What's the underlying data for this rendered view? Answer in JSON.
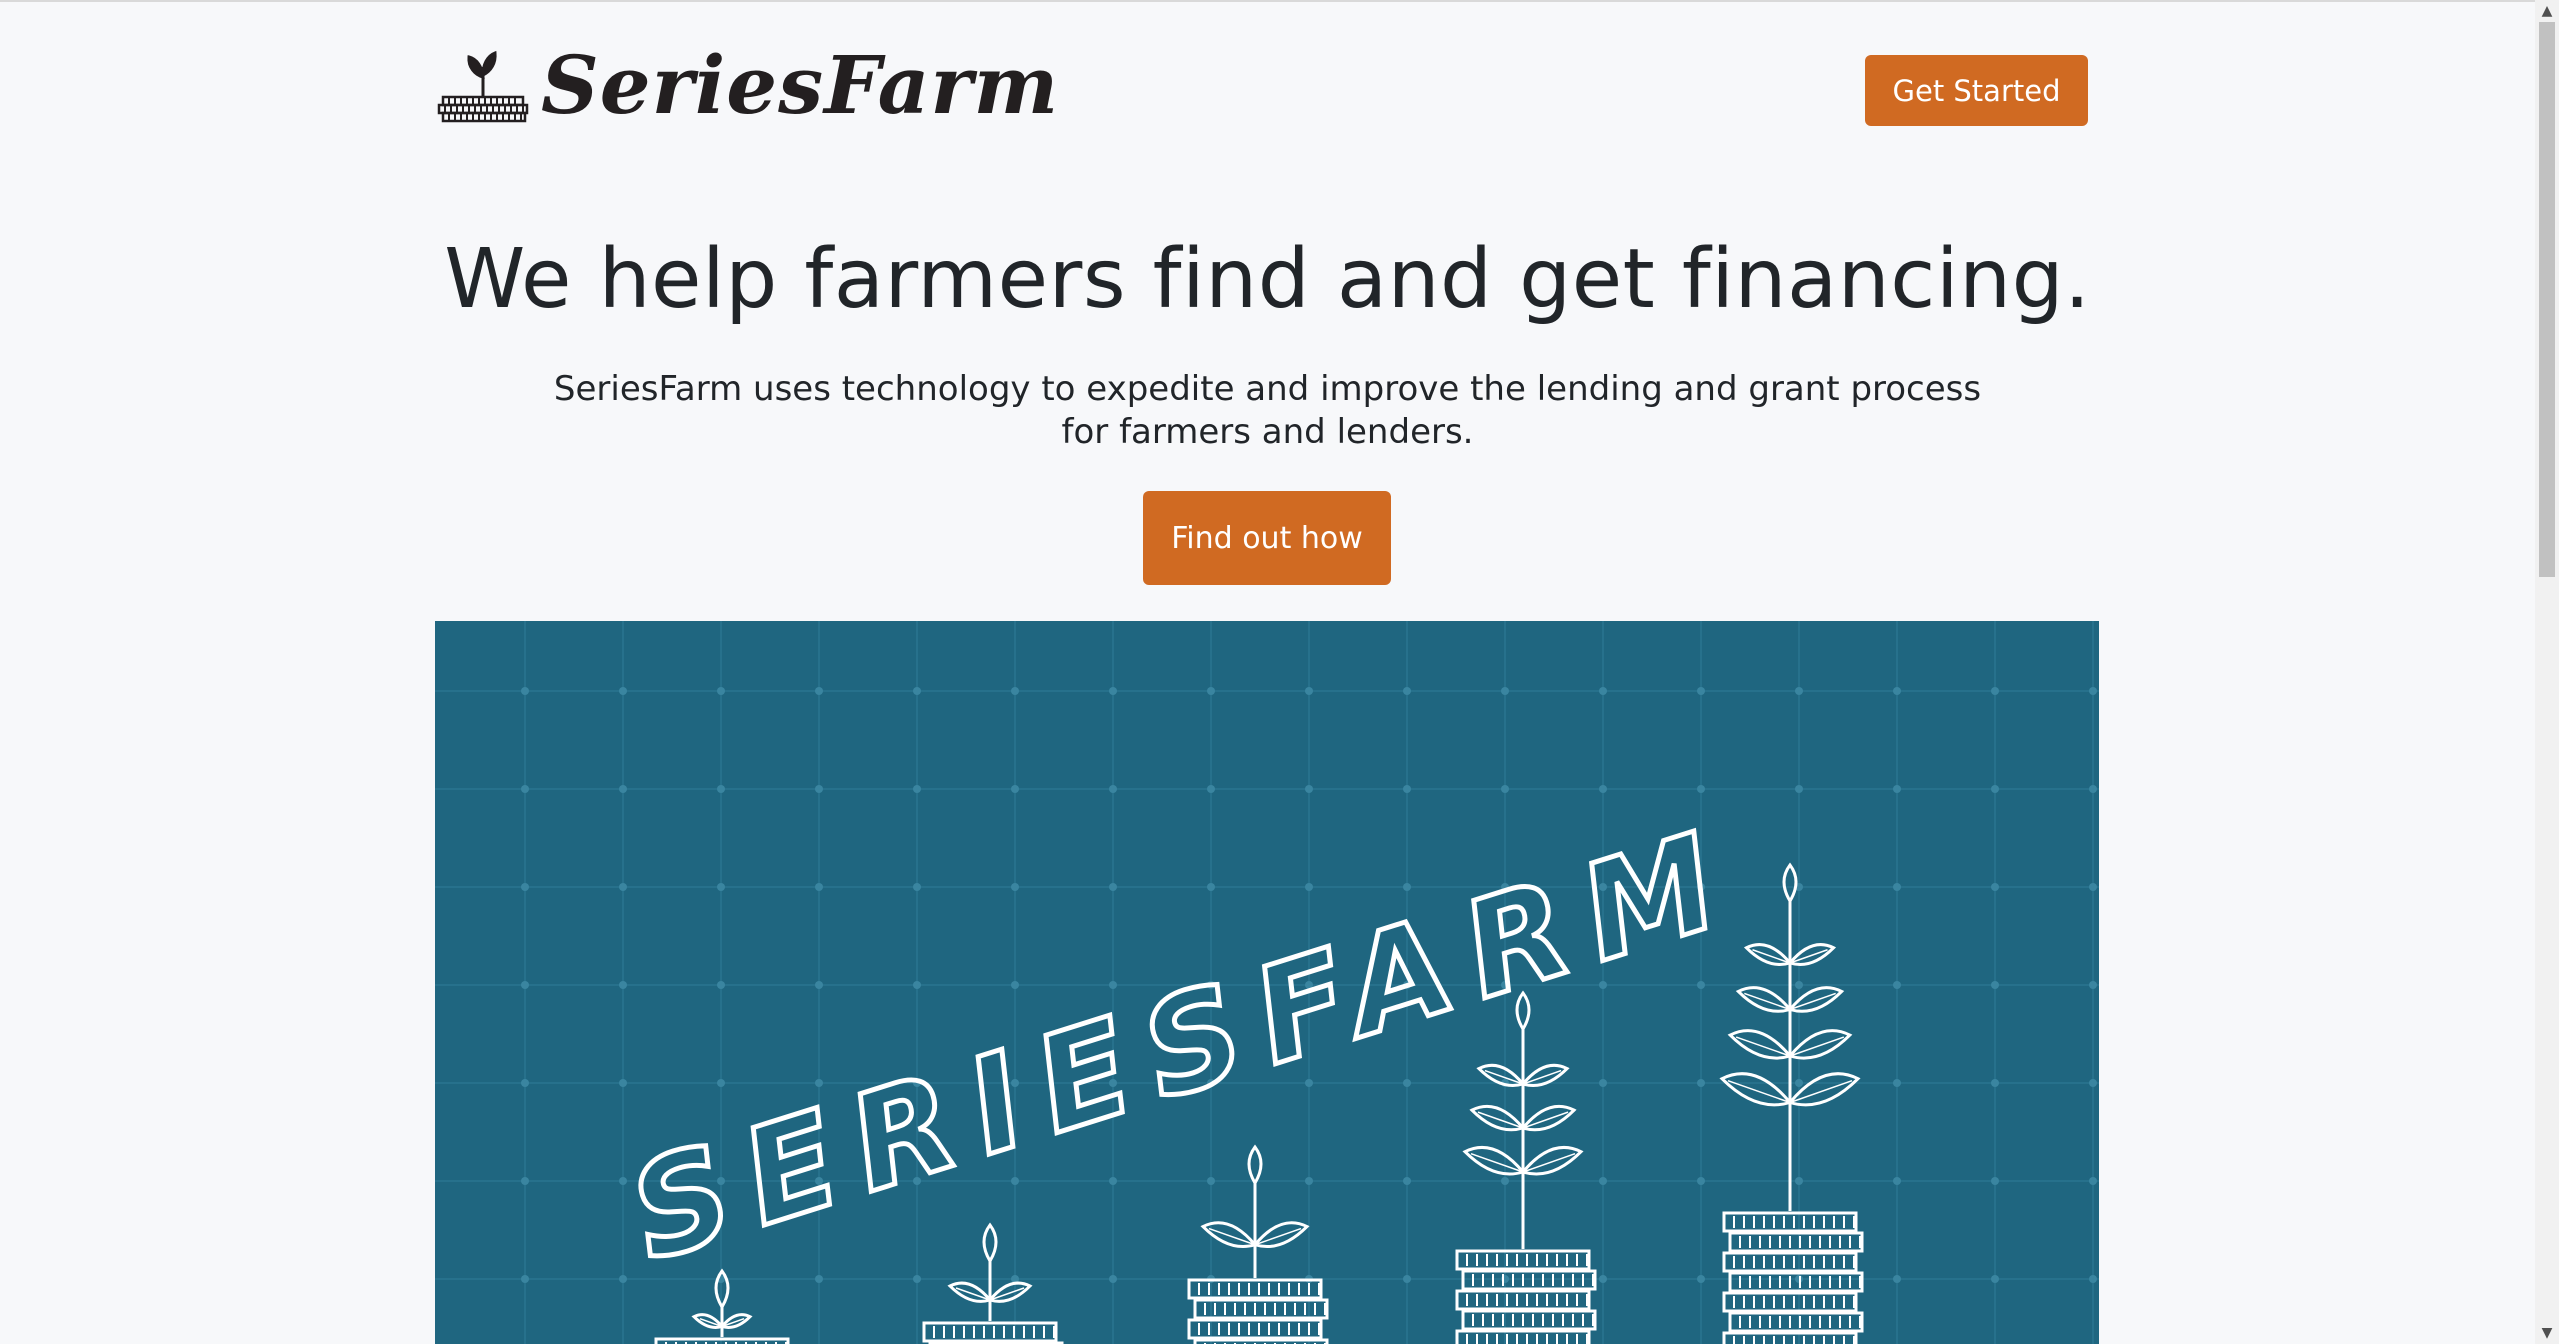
{
  "header": {
    "brand_name": "SeriesFarm",
    "brand_icon": "sprout-on-coins-logo",
    "cta_label": "Get Started"
  },
  "hero": {
    "title": "We help farmers find and get financing.",
    "subtitle": "SeriesFarm uses technology to expedite and improve the lending and grant process for farmers and lenders.",
    "cta_label": "Find out how"
  },
  "banner": {
    "text": "SERIESFARM",
    "background_color": "#1f6680",
    "illustration": "growing-plants-on-coin-stacks"
  },
  "colors": {
    "accent": "#d06a22",
    "page_background": "#f7f8fa",
    "banner": "#1f6680"
  }
}
